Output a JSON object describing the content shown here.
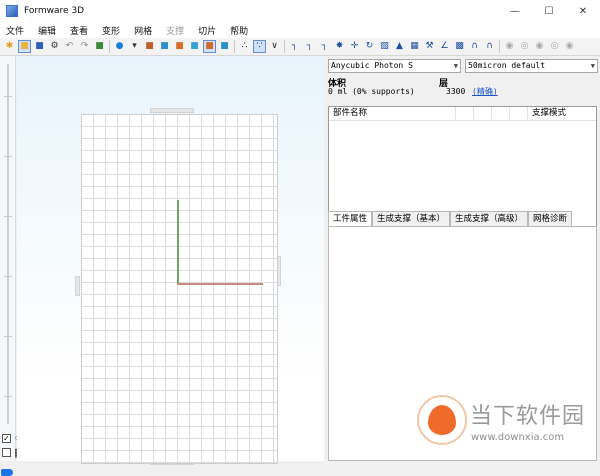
{
  "window": {
    "title": "Formware 3D",
    "min_glyph": "—",
    "max_glyph": "☐",
    "close_glyph": "✕"
  },
  "menu": [
    {
      "label": "文件",
      "enabled": true
    },
    {
      "label": "编辑",
      "enabled": true
    },
    {
      "label": "查看",
      "enabled": true
    },
    {
      "label": "变形",
      "enabled": true
    },
    {
      "label": "网格",
      "enabled": true
    },
    {
      "label": "支撑",
      "enabled": false
    },
    {
      "label": "切片",
      "enabled": true
    },
    {
      "label": "帮助",
      "enabled": true
    }
  ],
  "toolbar": {
    "icons": [
      {
        "name": "new-file-icon",
        "glyph": "✱",
        "color": "#e0a020"
      },
      {
        "name": "open-folder-icon",
        "glyph": "■",
        "color": "#e8b53a",
        "active": true
      },
      {
        "name": "save-icon",
        "glyph": "■",
        "color": "#2d5fb8"
      },
      {
        "name": "settings-gear-icon",
        "glyph": "⚙",
        "color": "#333333"
      },
      {
        "name": "undo-icon",
        "glyph": "↶",
        "color": "#8a8a8a"
      },
      {
        "name": "redo-icon",
        "glyph": "↷",
        "color": "#8a8a8a"
      },
      {
        "name": "copy-icon",
        "glyph": "■",
        "color": "#3a8a3a"
      },
      {
        "sep": true
      },
      {
        "name": "sphere-dropdown-icon",
        "glyph": "●",
        "color": "#1c7fd6"
      },
      {
        "name": "chevron-down-icon",
        "glyph": "▾",
        "color": "#333333"
      },
      {
        "name": "view-iso-icon",
        "glyph": "■",
        "color": "#c0602c"
      },
      {
        "name": "view-front-icon",
        "glyph": "■",
        "color": "#2c8fc9"
      },
      {
        "name": "view-side-icon",
        "glyph": "■",
        "color": "#d2702c"
      },
      {
        "name": "view-top-icon",
        "glyph": "■",
        "color": "#33a3d8"
      },
      {
        "name": "view-back-icon",
        "glyph": "■",
        "color": "#d06a2a",
        "active": true
      },
      {
        "name": "view-bottom-icon",
        "glyph": "■",
        "color": "#2c8fc9"
      },
      {
        "sep": true
      },
      {
        "name": "points-mode-icon",
        "glyph": "∴",
        "color": "#222222"
      },
      {
        "name": "points-select-icon",
        "glyph": "∵",
        "color": "#222222",
        "active": true
      },
      {
        "name": "points-branch-icon",
        "glyph": "∨",
        "color": "#222222"
      },
      {
        "sep": true
      },
      {
        "name": "align-floor-icon",
        "glyph": "┐",
        "color": "#1c4f9e"
      },
      {
        "name": "align-left-icon",
        "glyph": "┐",
        "color": "#1c4f9e"
      },
      {
        "name": "align-center-icon",
        "glyph": "┐",
        "color": "#1c4f9e"
      },
      {
        "name": "rotate-tool-icon",
        "glyph": "✸",
        "color": "#1c4f9e"
      },
      {
        "name": "move-tool-icon",
        "glyph": "✛",
        "color": "#1c4f9e"
      },
      {
        "name": "reload-icon",
        "glyph": "↻",
        "color": "#1c4f9e"
      },
      {
        "name": "cube-grid-icon",
        "glyph": "▧",
        "color": "#1c4f9e"
      },
      {
        "name": "warning-triangle-icon",
        "glyph": "▲",
        "color": "#1c4f9e"
      },
      {
        "name": "grid-mesh-icon",
        "glyph": "▦",
        "color": "#1c4f9e"
      },
      {
        "name": "hammer-icon",
        "glyph": "⚒",
        "color": "#1c4f9e"
      },
      {
        "name": "measure-icon",
        "glyph": "∠",
        "color": "#1c4f9e"
      },
      {
        "name": "qr-grid-icon",
        "glyph": "▩",
        "color": "#1c4f9e"
      },
      {
        "name": "arch-icon",
        "glyph": "∩",
        "color": "#1c4f9e"
      },
      {
        "name": "arch-plus-icon",
        "glyph": "∩",
        "color": "#1c4f9e"
      },
      {
        "sep": true
      },
      {
        "name": "support-disabled-1-icon",
        "glyph": "◉",
        "color": "#a8a8a8"
      },
      {
        "name": "support-disabled-2-icon",
        "glyph": "◎",
        "color": "#a8a8a8"
      },
      {
        "name": "support-disabled-3-icon",
        "glyph": "◉",
        "color": "#a8a8a8"
      },
      {
        "name": "support-disabled-4-icon",
        "glyph": "◎",
        "color": "#a8a8a8"
      },
      {
        "name": "support-disabled-5-icon",
        "glyph": "◉",
        "color": "#a8a8a8"
      }
    ]
  },
  "left_strip": {
    "checkbox_1_glyph": "✓",
    "drop_glyph": "⬭",
    "grid_glyph": "▦"
  },
  "printer": {
    "value": "Anycubic Photon S"
  },
  "profile": {
    "value": "50micron default"
  },
  "stats": {
    "volume_label": "体积",
    "volume_value": "0 ml (0% supports)",
    "layers_label": "层",
    "layers_value": "3300",
    "layers_link": "(精确)"
  },
  "parts_table": {
    "columns": [
      "部件名称",
      "",
      "",
      "",
      "",
      "支撑模式"
    ]
  },
  "tabs": [
    {
      "label": "工件属性",
      "active": true
    },
    {
      "label": "生成支撑（基本）",
      "active": false
    },
    {
      "label": "生成支撑（高级）",
      "active": false
    },
    {
      "label": "网格诊断",
      "active": false
    }
  ],
  "watermark": {
    "text": "当下软件园",
    "url": "www.downxia.com"
  }
}
